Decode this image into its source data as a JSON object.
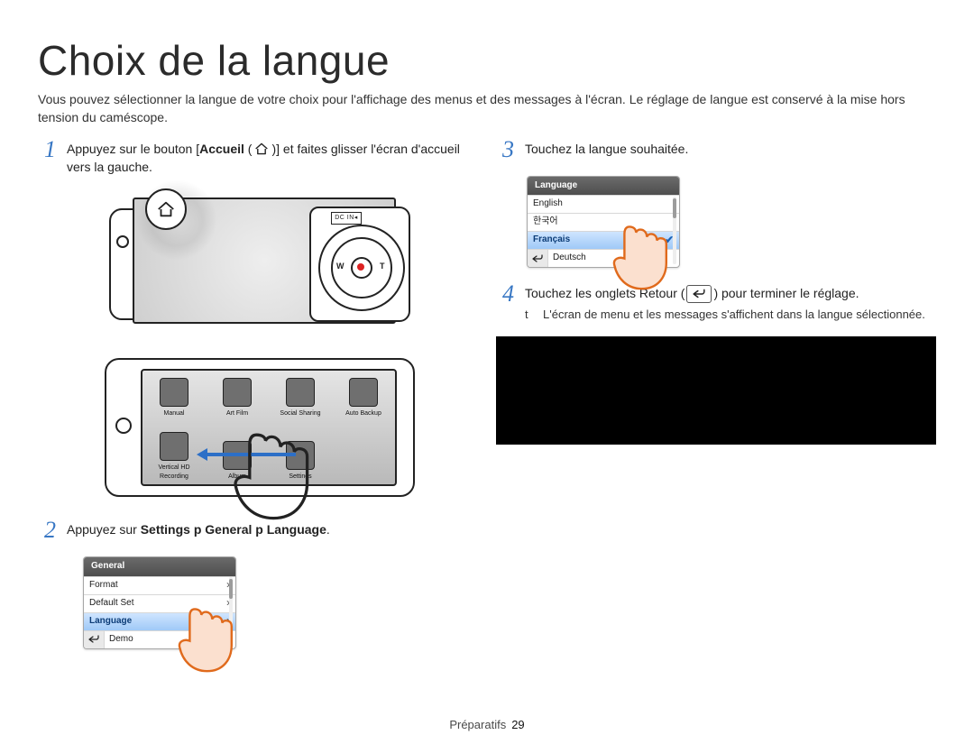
{
  "title": "Choix de la langue",
  "intro": "Vous pouvez sélectionner la langue de votre choix pour l'affichage des menus et des messages à l'écran. Le réglage de langue est conservé à la mise hors tension du caméscope.",
  "step1": {
    "pre": "Appuyez sur le bouton [",
    "bold": "Accueil",
    "mid": " (",
    "post": ")] et faites glisser l'écran d'accueil vers la gauche."
  },
  "cam_labels": {
    "dcin": "DC IN◂",
    "w": "W",
    "t": "T"
  },
  "home_icons": {
    "row1": [
      "Manual",
      "Art Film",
      "Social Sharing",
      "Auto Backup"
    ],
    "row2": [
      "Vertical HD Recording",
      "Album",
      "Settings"
    ]
  },
  "step2": {
    "pre": "Appuyez sur ",
    "path": "Settings  p  General  p  Language",
    "post": "."
  },
  "panel2": {
    "header": "General",
    "items": [
      "Format",
      "Default Set",
      "Language",
      "Demo"
    ],
    "selected": "Language"
  },
  "step3": "Touchez la langue souhaitée.",
  "panel3": {
    "header": "Language",
    "items": [
      "English",
      "한국어",
      "Français",
      "Deutsch"
    ],
    "selected": "Français"
  },
  "step4": {
    "pre": "Touchez les onglets Retour (",
    "post": ") pour terminer le réglage."
  },
  "step4_bullet": {
    "mark": "t",
    "text": "L'écran de menu et les messages s'affichent dans la langue sélectionnée."
  },
  "footer": {
    "section": "Préparatifs",
    "page": "29"
  }
}
